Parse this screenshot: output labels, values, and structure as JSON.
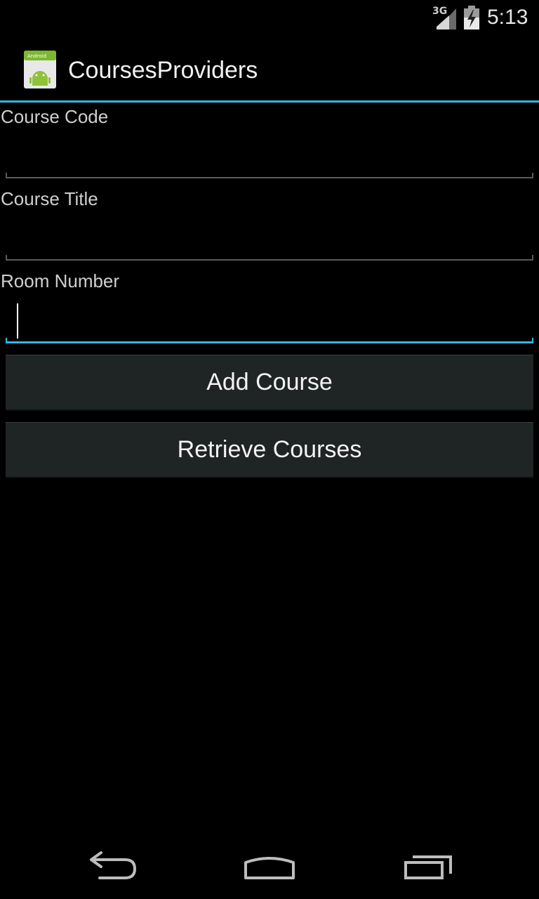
{
  "status_bar": {
    "network": "3G",
    "time": "5:13",
    "signal_icon": "signal-icon",
    "battery_icon": "battery-charging-icon"
  },
  "action_bar": {
    "title": "CoursesProviders",
    "app_icon": "android-app-icon",
    "app_icon_text": "Android",
    "accent_color": "#33b5e5"
  },
  "form": {
    "course_code": {
      "label": "Course Code",
      "value": ""
    },
    "course_title": {
      "label": "Course Title",
      "value": ""
    },
    "room_number": {
      "label": "Room Number",
      "value": ""
    }
  },
  "buttons": {
    "add": "Add Course",
    "retrieve": "Retrieve Courses"
  },
  "nav_bar": {
    "back_icon": "back-icon",
    "home_icon": "home-icon",
    "recents_icon": "recent-apps-icon"
  }
}
